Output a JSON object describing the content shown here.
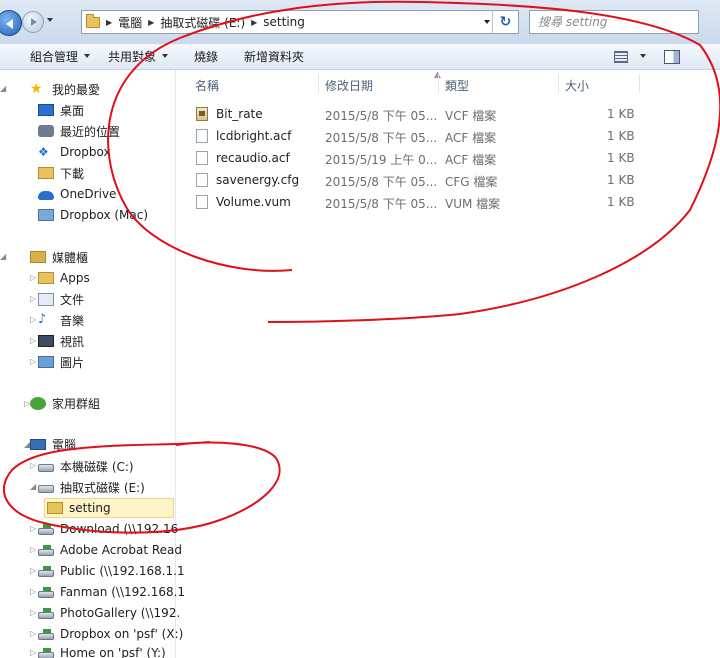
{
  "address_bar": {
    "breadcrumbs": [
      "電腦",
      "抽取式磁碟 (E:)",
      "setting"
    ],
    "search_placeholder": "搜尋 setting"
  },
  "toolbar": {
    "organize": "組合管理",
    "share": "共用對象",
    "burn": "燒錄",
    "new_folder": "新增資料夾"
  },
  "sidebar": {
    "favorites": {
      "header": "我的最愛",
      "items": [
        "桌面",
        "最近的位置",
        "Dropbox",
        "下載",
        "OneDrive",
        "Dropbox (Mac)"
      ]
    },
    "libraries": {
      "header": "媒體櫃",
      "items": [
        "Apps",
        "文件",
        "音樂",
        "視訊",
        "圖片"
      ]
    },
    "homegroup": "家用群組",
    "computer": {
      "header": "電腦",
      "local_disk": "本機磁碟 (C:)",
      "removable": "抽取式磁碟 (E:)",
      "selected_folder": "setting",
      "network_drives": [
        "Download (\\\\192.16",
        "Adobe Acrobat Read",
        "Public (\\\\192.168.1.1",
        "Fanman (\\\\192.168.1",
        "PhotoGallery (\\\\192.",
        "Dropbox on 'psf' (X:)",
        "Home on 'psf' (Y:)"
      ]
    }
  },
  "file_list": {
    "columns": {
      "name": "名稱",
      "date": "修改日期",
      "type": "類型",
      "size": "大小"
    },
    "rows": [
      {
        "name": "Bit_rate",
        "date": "2015/5/8 下午 05...",
        "type": "VCF 檔案",
        "size": "1 KB",
        "icon": "vcf-file-icon"
      },
      {
        "name": "lcdbright.acf",
        "date": "2015/5/8 下午 05...",
        "type": "ACF 檔案",
        "size": "1 KB",
        "icon": "file-icon"
      },
      {
        "name": "recaudio.acf",
        "date": "2015/5/19 上午 0...",
        "type": "ACF 檔案",
        "size": "1 KB",
        "icon": "file-icon"
      },
      {
        "name": "savenergy.cfg",
        "date": "2015/5/8 下午 05...",
        "type": "CFG 檔案",
        "size": "1 KB",
        "icon": "file-icon"
      },
      {
        "name": "Volume.vum",
        "date": "2015/5/8 下午 05...",
        "type": "VUM 檔案",
        "size": "1 KB",
        "icon": "file-icon"
      }
    ]
  },
  "colors": {
    "annotation": "#e0101a",
    "selection_bg": "#fff3c8",
    "header_text": "#4b5f7a"
  }
}
